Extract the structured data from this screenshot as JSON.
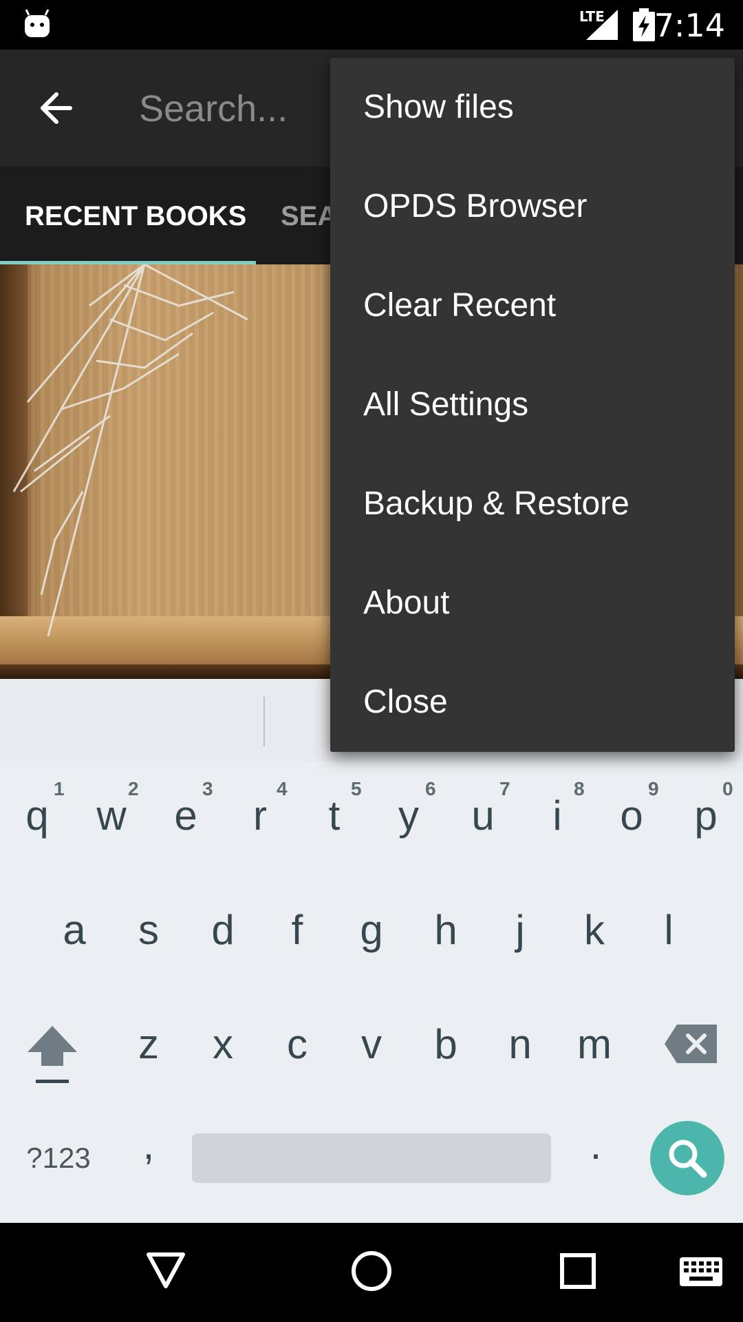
{
  "status_bar": {
    "time": "7:14",
    "network_label": "LTE",
    "icons": [
      "android-notification-icon",
      "lte-signal-icon",
      "battery-charging-icon"
    ]
  },
  "app_bar": {
    "back_icon": "arrow-left-icon",
    "search": {
      "placeholder": "Search...",
      "value": ""
    }
  },
  "tabs": [
    {
      "label": "RECENT BOOKS",
      "selected": true
    },
    {
      "label": "SEA",
      "selected": false
    }
  ],
  "overflow_menu": {
    "items": [
      {
        "label": "Show files"
      },
      {
        "label": "OPDS Browser"
      },
      {
        "label": "Clear Recent"
      },
      {
        "label": "All Settings"
      },
      {
        "label": "Backup & Restore"
      },
      {
        "label": "About"
      },
      {
        "label": "Close"
      }
    ]
  },
  "keyboard": {
    "row1": [
      {
        "key": "q",
        "hint": "1"
      },
      {
        "key": "w",
        "hint": "2"
      },
      {
        "key": "e",
        "hint": "3"
      },
      {
        "key": "r",
        "hint": "4"
      },
      {
        "key": "t",
        "hint": "5"
      },
      {
        "key": "y",
        "hint": "6"
      },
      {
        "key": "u",
        "hint": "7"
      },
      {
        "key": "i",
        "hint": "8"
      },
      {
        "key": "o",
        "hint": "9"
      },
      {
        "key": "p",
        "hint": "0"
      }
    ],
    "row2": [
      "a",
      "s",
      "d",
      "f",
      "g",
      "h",
      "j",
      "k",
      "l"
    ],
    "row3": [
      "z",
      "x",
      "c",
      "v",
      "b",
      "n",
      "m"
    ],
    "symbols_label": "?123",
    "comma": ",",
    "period": ".",
    "shift_icon": "shift-arrow-icon",
    "backspace_icon": "backspace-icon",
    "action_icon": "search-icon",
    "accent_color": "#4db6ac"
  },
  "nav_bar": {
    "icons": [
      "back-triangle-icon",
      "home-circle-icon",
      "recents-square-icon",
      "keyboard-icon"
    ]
  },
  "colors": {
    "tab_indicator": "#7fd0c2",
    "menu_background": "#333333",
    "app_bar": "#262626"
  }
}
